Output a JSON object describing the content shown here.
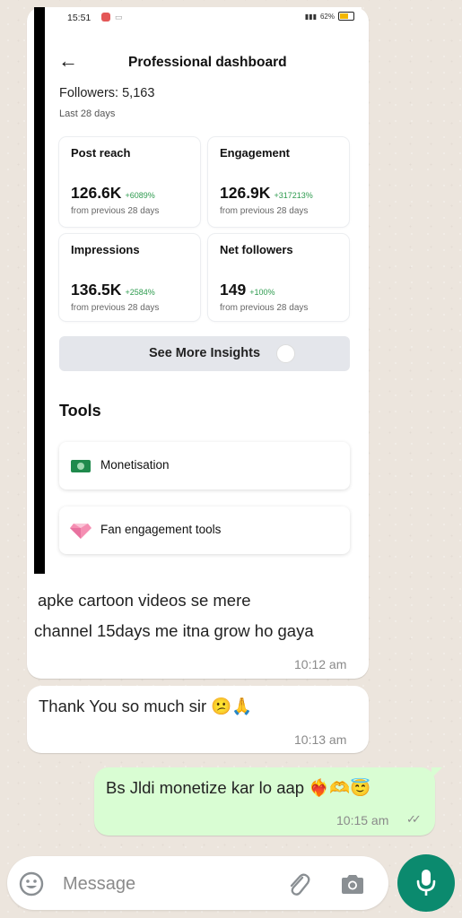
{
  "chat": {
    "messages": [
      {
        "direction": "incoming",
        "screenshot": {
          "status_bar": {
            "time": "15:51",
            "battery": "62%"
          },
          "header": {
            "title": "Professional dashboard"
          },
          "followers": {
            "text": "Followers: 5,163",
            "period": "Last 28 days"
          },
          "metrics": [
            {
              "label": "Post reach",
              "value": "126.6K",
              "change": "+6089%",
              "sub": "from previous 28 days"
            },
            {
              "label": "Engagement",
              "value": "126.9K",
              "change": "+317213%",
              "sub": "from previous 28 days"
            },
            {
              "label": "Impressions",
              "value": "136.5K",
              "change": "+2584%",
              "sub": "from previous 28 days"
            },
            {
              "label": "Net followers",
              "value": "149",
              "change": "+100%",
              "sub": "from previous 28 days"
            }
          ],
          "insights_button": "See More Insights",
          "tools": {
            "title": "Tools",
            "items": [
              {
                "label": "Monetisation",
                "icon": "money-icon"
              },
              {
                "label": "Fan engagement tools",
                "icon": "diamond-icon"
              }
            ]
          }
        },
        "text_line1": "apke cartoon videos se mere",
        "text_line2": "channel 15days me itna grow ho gaya",
        "time": "10:12 am"
      },
      {
        "direction": "incoming",
        "text": "Thank You so much sir 😕🙏",
        "time": "10:13 am"
      },
      {
        "direction": "outgoing",
        "text": "Bs Jldi monetize kar lo aap ❤️‍🔥🫶😇",
        "time": "10:15 am",
        "status": "read"
      }
    ]
  },
  "composer": {
    "placeholder": "Message",
    "icons": [
      "emoji-icon",
      "attachment-icon",
      "camera-icon",
      "mic-icon"
    ],
    "accent_color": "#0b8a6e"
  },
  "colors": {
    "outgoing_bubble": "#d9fdd3",
    "incoming_bubble": "#ffffff",
    "chat_background": "#ece5dd",
    "change_positive": "#2e9b4f"
  }
}
